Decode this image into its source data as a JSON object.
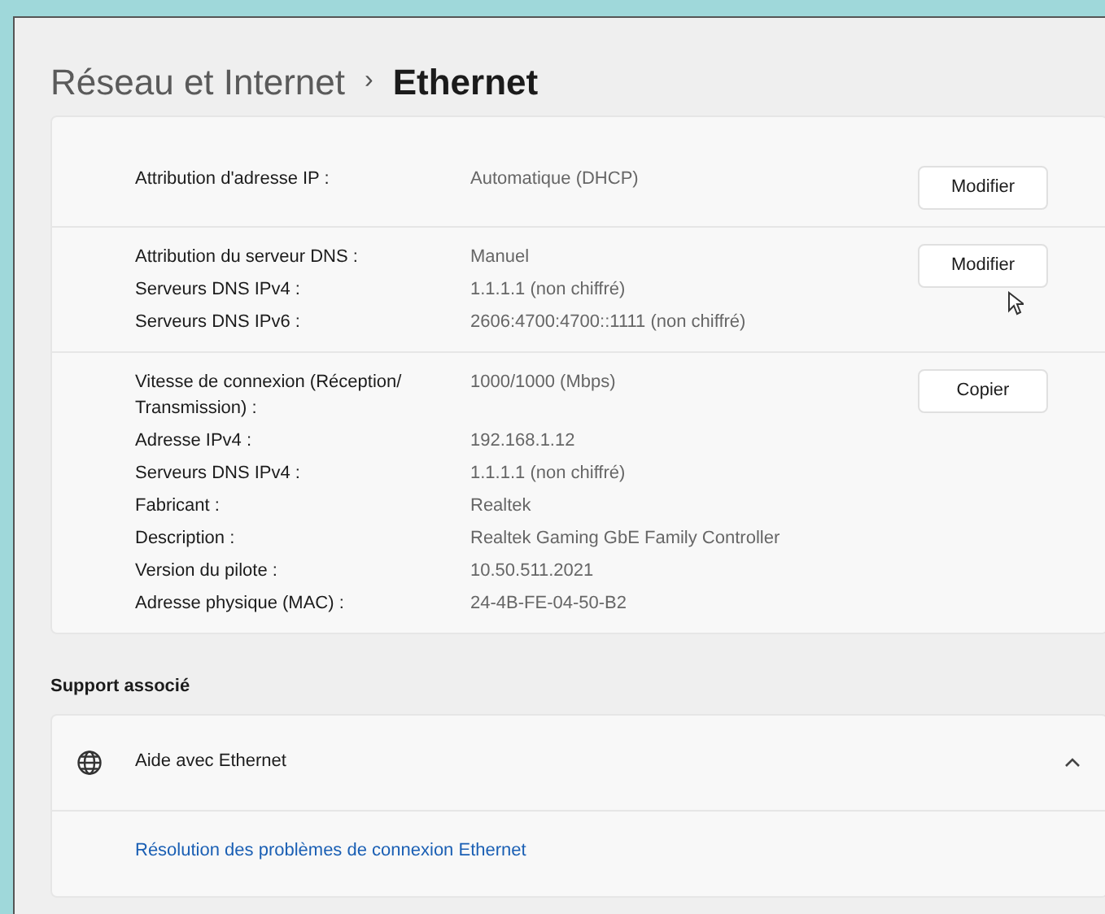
{
  "breadcrumb": {
    "parent": "Réseau et Internet",
    "separator": "›",
    "current": "Ethernet"
  },
  "sections": [
    {
      "button": "Modifier",
      "rows": [
        {
          "label": "Attribution d'adresse IP :",
          "value": "Automatique (DHCP)"
        }
      ]
    },
    {
      "button": "Modifier",
      "rows": [
        {
          "label": "Attribution du serveur DNS :",
          "value": "Manuel"
        },
        {
          "label": "Serveurs DNS IPv4 :",
          "value": "1.1.1.1 (non chiffré)"
        },
        {
          "label": "Serveurs DNS IPv6 :",
          "value": "2606:4700:4700::1111 (non chiffré)"
        }
      ]
    },
    {
      "button": "Copier",
      "rows": [
        {
          "label": "Vitesse de connexion (Réception/ Transmission) :",
          "value": "1000/1000 (Mbps)"
        },
        {
          "label": "Adresse IPv4 :",
          "value": "192.168.1.12"
        },
        {
          "label": "Serveurs DNS IPv4 :",
          "value": "1.1.1.1 (non chiffré)"
        },
        {
          "label": "Fabricant :",
          "value": "Realtek"
        },
        {
          "label": "Description :",
          "value": "Realtek Gaming GbE Family Controller"
        },
        {
          "label": "Version du pilote :",
          "value": "10.50.511.2021"
        },
        {
          "label": "Adresse physique (MAC) :",
          "value": "24-4B-FE-04-50-B2"
        }
      ]
    }
  ],
  "support": {
    "heading": "Support associé",
    "title": "Aide avec Ethernet",
    "expanded": true,
    "links": [
      "Résolution des problèmes de connexion Ethernet"
    ]
  }
}
